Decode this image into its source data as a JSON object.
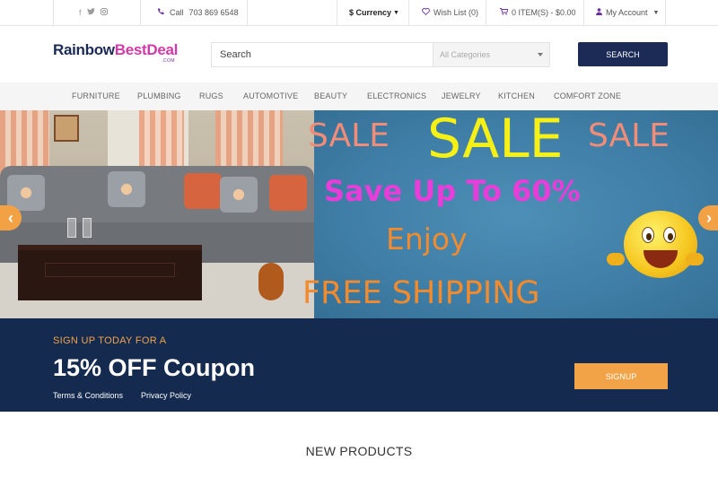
{
  "topbar": {
    "social": [
      "f",
      "t",
      "ig"
    ],
    "social_icons": [
      "facebook-icon",
      "twitter-icon",
      "instagram-icon"
    ],
    "phone_label": "Call",
    "phone_number": "703 869 6548",
    "currency_label": "$ Currency",
    "wishlist_label": "Wish List (0)",
    "cart_label": "0 ITEM(S) - $0.00",
    "account_label": "My Account"
  },
  "header": {
    "logo_part1": "Rainbow",
    "logo_part2": "BestDeal",
    "logo_sub": ".COM",
    "search_placeholder": "Search",
    "category_selected": "All Categories",
    "search_button": "SEARCH"
  },
  "nav": {
    "items": [
      "FURNITURE",
      "PLUMBING",
      "RUGS",
      "AUTOMOTIVE",
      "BEAUTY",
      "ELECTRONICS",
      "JEWELRY",
      "KITCHEN",
      "COMFORT ZONE"
    ]
  },
  "hero": {
    "sale_left": "SALE",
    "sale_center": "SALE",
    "sale_right": "SALE",
    "save_line": "Save Up To 60%",
    "enjoy_line": "Enjoy",
    "free_line": "FREE SHIPPING",
    "prev_arrow": "‹",
    "next_arrow": "›"
  },
  "coupon": {
    "pretitle": "SIGN UP TODAY FOR A",
    "title": "15% OFF Coupon",
    "terms": "Terms & Conditions",
    "privacy": "Privacy Policy",
    "signup_button": "SIGNUP"
  },
  "sections": {
    "new_products": "NEW PRODUCTS"
  },
  "colors": {
    "navy": "#1b2b55",
    "accent_orange": "#f2a348",
    "brand_purple": "#6b2fa0",
    "brand_pink": "#d23aa8"
  }
}
